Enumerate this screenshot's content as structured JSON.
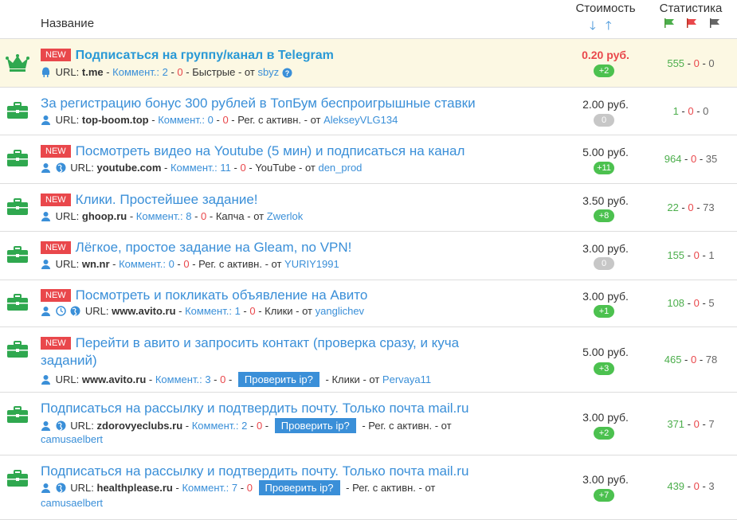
{
  "header": {
    "name_col": "Название",
    "cost_col": "Стоимость",
    "stats_col": "Статистика",
    "sort_down": "🡓",
    "sort_up": "🡑"
  },
  "labels": {
    "url": "URL:",
    "comment": "Коммент.:",
    "from": "от",
    "dash": "-",
    "check_ip": "Проверить ip?",
    "new": "NEW",
    "help": "?"
  },
  "colors": {
    "accent": "#3a8fd8",
    "new_badge": "#e9474b",
    "pill_green": "#4cc14f",
    "highlight": "#fcf8e3",
    "icon_green": "#2fa84f"
  },
  "rows": [
    {
      "new": true,
      "featured": true,
      "title": "Подписаться на группу/канал в Telegram",
      "url": "t.me",
      "comments": "2",
      "comments_neg": "0",
      "extra": "Быстрые",
      "author": "sbyz",
      "price": "0.20 руб.",
      "pill": "+2",
      "stats": [
        "555",
        "0",
        "0"
      ]
    },
    {
      "new": false,
      "title": "За регистрацию бонус 300 рублей в ТопБум беспроигрышные ставки",
      "url": "top-boom.top",
      "comments": "0",
      "comments_neg": "0",
      "extra": "Рег. с активн.",
      "author": "AlekseyVLG134",
      "price": "2.00 руб.",
      "pill": "0",
      "stats": [
        "1",
        "0",
        "0"
      ]
    },
    {
      "new": true,
      "title": "Посмотреть видео на Youtube (5 мин) и подписаться на канал",
      "url": "youtube.com",
      "comments": "11",
      "comments_neg": "0",
      "extra": "YouTube",
      "author": "den_prod",
      "price": "5.00 руб.",
      "pill": "+11",
      "stats": [
        "964",
        "0",
        "35"
      ]
    },
    {
      "new": true,
      "title": "Клики. Простейшее задание!",
      "url": "ghoop.ru",
      "comments": "8",
      "comments_neg": "0",
      "extra": "Капча",
      "author": "Zwerlok",
      "price": "3.50 руб.",
      "pill": "+8",
      "stats": [
        "22",
        "0",
        "73"
      ]
    },
    {
      "new": true,
      "title": "Лёгкое, простое задание на Gleam, no VPN!",
      "url": "wn.nr",
      "comments": "0",
      "comments_neg": "0",
      "extra": "Рег. с активн.",
      "author": "YURIY1991",
      "price": "3.00 руб.",
      "pill": "0",
      "stats": [
        "155",
        "0",
        "1"
      ]
    },
    {
      "new": true,
      "title": "Посмотреть и покликать объявление на Авито",
      "url": "www.avito.ru",
      "comments": "1",
      "comments_neg": "0",
      "extra": "Клики",
      "author": "yanglichev",
      "price": "3.00 руб.",
      "pill": "+1",
      "stats": [
        "108",
        "0",
        "5"
      ]
    },
    {
      "new": true,
      "title_1": "Перейти в авито и запросить контакт (проверка сразу, и куча",
      "title_2": "заданий)",
      "url": "www.avito.ru",
      "comments": "3",
      "comments_neg": "0",
      "extra": "Клики",
      "author": "Pervaya11",
      "price": "5.00 руб.",
      "pill": "+3",
      "stats": [
        "465",
        "0",
        "78"
      ]
    },
    {
      "new": false,
      "title": "Подписаться на рассылку и подтвердить почту. Только почта mail.ru",
      "url": "zdorovyeclubs.ru",
      "comments": "2",
      "comments_neg": "0",
      "extra": "Рег. с активн.",
      "from_label": "- от",
      "author": "camusaelbert",
      "price": "3.00 руб.",
      "pill": "+2",
      "stats": [
        "371",
        "0",
        "7"
      ]
    },
    {
      "new": false,
      "title": "Подписаться на рассылку и подтвердить почту. Только почта mail.ru",
      "url": "healthplease.ru",
      "comments": "7",
      "comments_neg": "0",
      "extra": "Рег. с активн.",
      "from_label": "- от",
      "author": "camusaelbert",
      "price": "3.00 руб.",
      "pill": "+7",
      "stats": [
        "439",
        "0",
        "3"
      ]
    }
  ]
}
